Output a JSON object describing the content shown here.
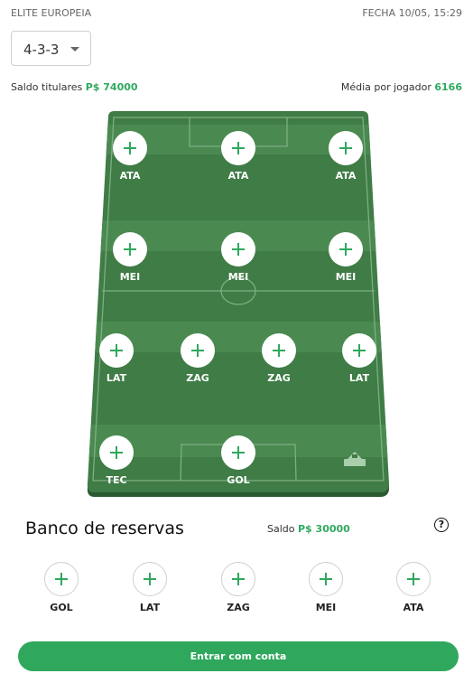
{
  "header": {
    "league": "ELITE EUROPEIA",
    "deadline": "FECHA 10/05, 15:29"
  },
  "formation": {
    "selected": "4-3-3"
  },
  "budget": {
    "titulares_label": "Saldo titulares",
    "titulares_value": "P$ 74000",
    "media_label": "Média por jogador",
    "media_value": "6166"
  },
  "field": {
    "rows": [
      {
        "slots": [
          "ATA",
          "ATA",
          "ATA"
        ]
      },
      {
        "slots": [
          "MEI",
          "MEI",
          "MEI"
        ]
      },
      {
        "slots": [
          "LAT",
          "ZAG",
          "ZAG",
          "LAT"
        ]
      },
      {
        "slots": [
          "TEC",
          "GOL"
        ]
      }
    ],
    "rotate_icon": "stadium-rotate-icon"
  },
  "bench": {
    "title": "Banco de reservas",
    "saldo_label": "Saldo",
    "saldo_value": "P$ 30000",
    "help_icon": "question-icon",
    "help_symbol": "?",
    "slots": [
      "GOL",
      "LAT",
      "ZAG",
      "MEI",
      "ATA"
    ]
  },
  "actions": {
    "enter_label": "Entrar com conta"
  },
  "colors": {
    "accent": "#2fa85d",
    "field_dark": "#3d7b45",
    "field_light": "#4b8a52"
  }
}
